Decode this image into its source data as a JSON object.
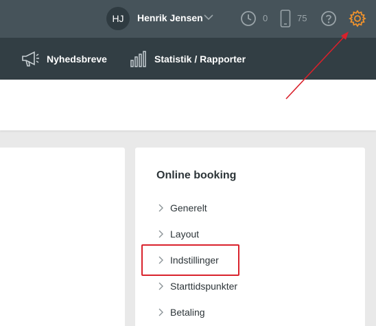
{
  "topbar": {
    "avatar_initials": "HJ",
    "user_name": "Henrik Jensen",
    "clock_count": "0",
    "device_count": "75"
  },
  "nav": {
    "items": [
      {
        "label": "Nyhedsbreve",
        "icon": "megaphone-icon"
      },
      {
        "label": "Statistik / Rapporter",
        "icon": "bar-chart-icon"
      }
    ]
  },
  "panel": {
    "title": "Online booking",
    "items": [
      {
        "label": "Generelt"
      },
      {
        "label": "Layout"
      },
      {
        "label": "Indstillinger"
      },
      {
        "label": "Starttidspunkter"
      },
      {
        "label": "Betaling"
      }
    ]
  },
  "colors": {
    "topbar": "#46535a",
    "navbar": "#323e44",
    "settings_accent": "#f0922c",
    "annotation_red": "#d9212b"
  }
}
